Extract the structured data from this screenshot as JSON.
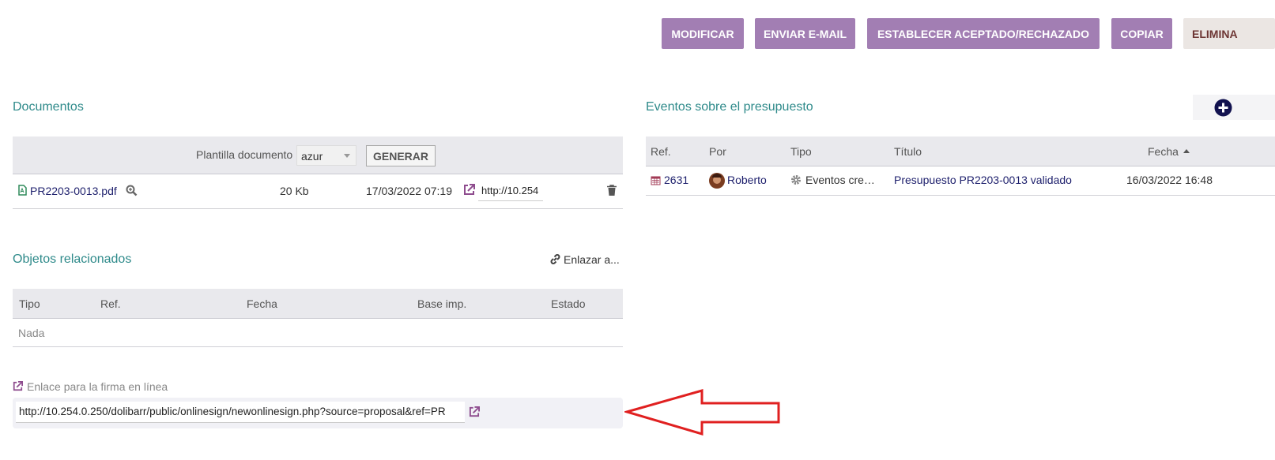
{
  "toolbar": {
    "modify": "MODIFICAR",
    "send_email": "ENVIAR E-MAIL",
    "set_status": "ESTABLECER ACEPTADO/RECHAZADO",
    "copy": "COPIAR",
    "delete": "ELIMINA"
  },
  "documents": {
    "title": "Documentos",
    "template_label": "Plantilla documento",
    "template_value": "azur",
    "generate_label": "GENERAR",
    "file": {
      "name": "PR2203-0013.pdf",
      "size": "20 Kb",
      "date": "17/03/2022 07:19",
      "share_url": "http://10.254"
    }
  },
  "related": {
    "title": "Objetos relacionados",
    "link_label": "Enlazar a...",
    "columns": [
      "Tipo",
      "Ref.",
      "Fecha",
      "Base imp.",
      "Estado"
    ],
    "empty_text": "Nada"
  },
  "online_sign": {
    "label": "Enlace para la firma en línea",
    "url": "http://10.254.0.250/dolibarr/public/onlinesign/newonlinesign.php?source=proposal&ref=PR"
  },
  "events": {
    "title": "Eventos sobre el presupuesto",
    "columns": [
      "Ref.",
      "Por",
      "Tipo",
      "Título",
      "Fecha"
    ],
    "rows": [
      {
        "ref": "2631",
        "by": "Roberto",
        "type": "Eventos cre…",
        "title": "Presupuesto PR2203-0013 validado",
        "date": "16/03/2022 16:48"
      }
    ]
  },
  "colors": {
    "button": "#a27eb3",
    "section_title": "#2e8a8a",
    "link": "#1d1f6c",
    "arrow": "#e02020"
  },
  "icons": [
    "pdf-file-icon",
    "zoom-icon",
    "external-link-icon",
    "trash-icon",
    "link-icon",
    "calendar-icon",
    "avatar",
    "gear-icon",
    "sort-asc-icon",
    "add-circle-icon",
    "arrow-left-icon"
  ]
}
